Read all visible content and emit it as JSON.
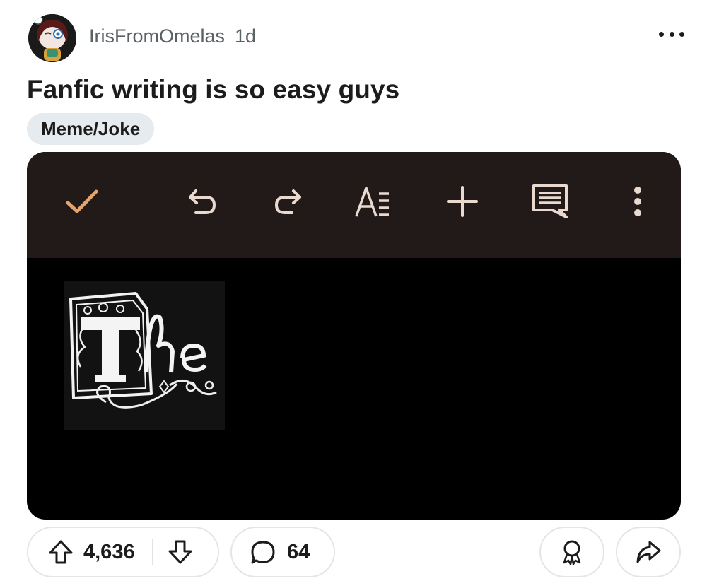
{
  "post": {
    "username": "IrisFromOmelas",
    "age": "1d",
    "title": "Fanfic writing is so easy guys",
    "flair": "Meme/Joke"
  },
  "media": {
    "toolbar_icons": [
      "check-icon",
      "undo-icon",
      "redo-icon",
      "text-format-icon",
      "plus-icon",
      "comment-icon",
      "more-vertical-icon"
    ],
    "accent_color": "#e8a36a",
    "toolbar_bg": "#211a19",
    "art_text": "The"
  },
  "actions": {
    "upvotes": "4,636",
    "comments": "64"
  }
}
